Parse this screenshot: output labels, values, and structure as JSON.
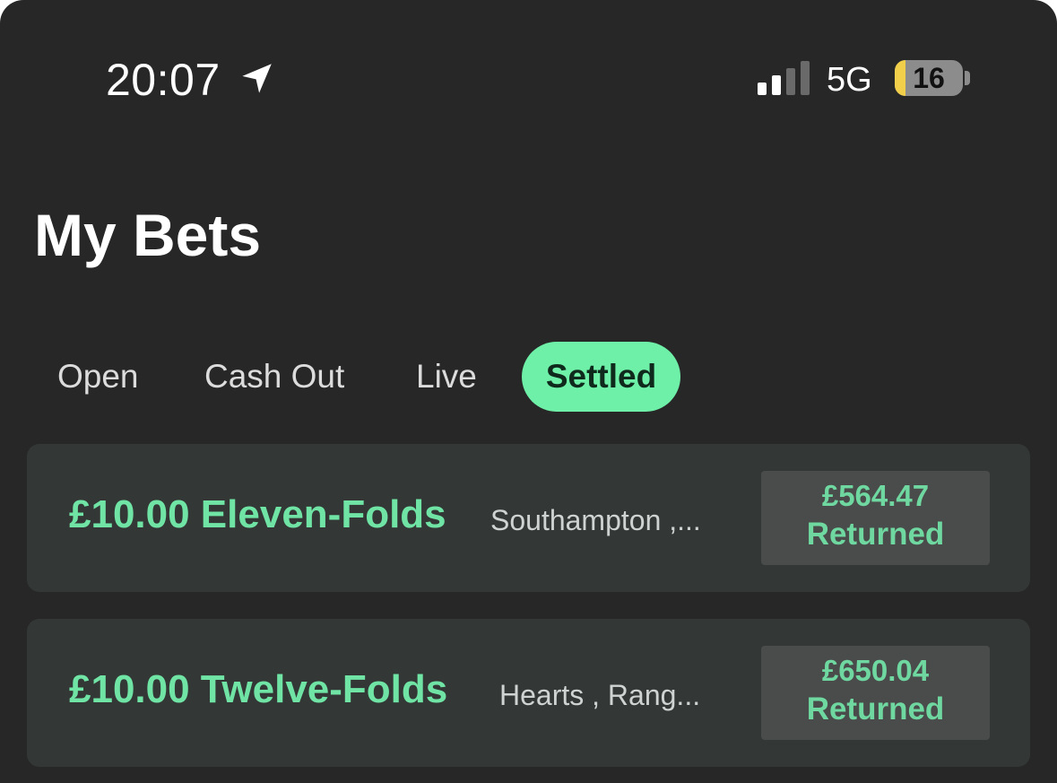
{
  "status_bar": {
    "time": "20:07",
    "location_icon": "location-arrow-icon",
    "signal_icon": "cellular-signal-icon",
    "signal_bars_active": 2,
    "signal_bars_total": 4,
    "network": "5G",
    "battery_icon": "battery-icon",
    "battery_level": "16",
    "battery_fraction": 0.16,
    "battery_fill_color": "#f2cf4a"
  },
  "header": {
    "title": "My Bets"
  },
  "tabs": [
    {
      "label": "Open",
      "active": false
    },
    {
      "label": "Cash Out",
      "active": false
    },
    {
      "label": "Live",
      "active": false
    },
    {
      "label": "Settled",
      "active": true
    }
  ],
  "bets": [
    {
      "title": "£10.00 Eleven-Folds",
      "selections": "Southampton ,...",
      "return_amount": "£564.47",
      "return_label": "Returned"
    },
    {
      "title": "£10.00 Twelve-Folds",
      "selections": "Hearts , Rang...",
      "return_amount": "£650.04",
      "return_label": "Returned"
    }
  ],
  "colors": {
    "background": "#272727",
    "accent": "#6ef0a8",
    "bet_title": "#6fe4a5",
    "card": "#333836",
    "return_box": "#4a4c4b"
  }
}
